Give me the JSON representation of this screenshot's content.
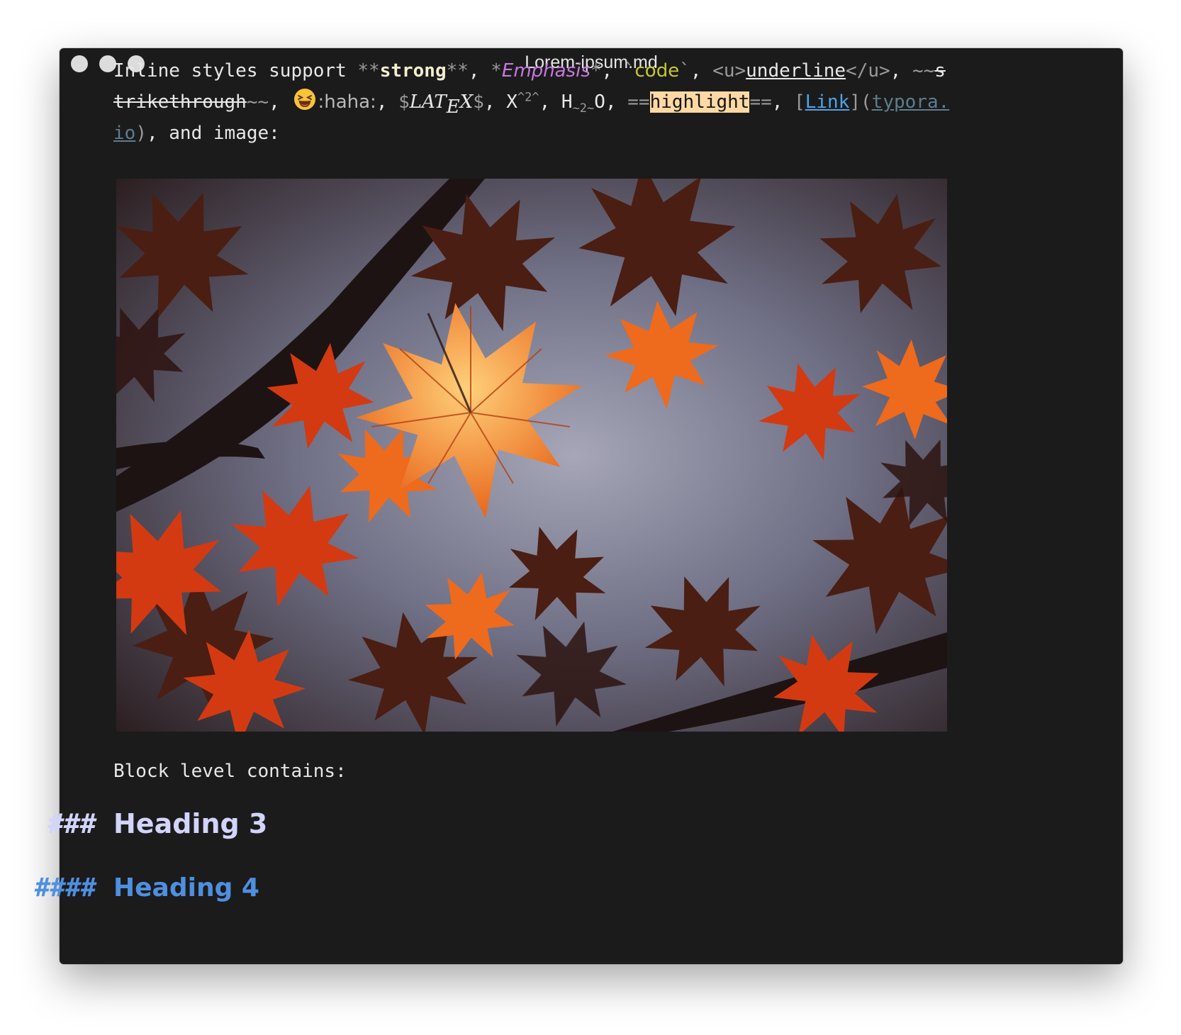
{
  "window": {
    "title": "Lorem-ipsum.md"
  },
  "paragraph": {
    "intro": "Inline styles support ",
    "strong_open": "**",
    "strong_text": "strong",
    "strong_close": "**",
    "sep1": ", ",
    "em_open": "*",
    "em_text": "Emphasis",
    "em_close": "*",
    "sep2": ", ",
    "code_open": "`",
    "code_text": "code",
    "code_close": "`",
    "sep3": ", ",
    "u_open": "<u>",
    "u_text": "underline",
    "u_close": "</u>",
    "sep4": ",",
    "strike_open": "~~",
    "strike_text": "strikethrough",
    "strike_close": "~~",
    "sep5": ", ",
    "emoji_code": ":haha:",
    "sep6": ", ",
    "latex_open": "$",
    "latex_la": "LA",
    "latex_t": "T",
    "latex_e": "E",
    "latex_x": "X",
    "latex_close": "$",
    "sep7": ", ",
    "sup_base": "X",
    "sup_mark": "^2^",
    "sep8": ", ",
    "sub_base": "H",
    "sub_mark": "~2~",
    "sub_tail": "O",
    "sep9": ", ",
    "hl_open": "==",
    "hl_text": "highlight",
    "hl_close": "==",
    "sep10": ", ",
    "link_open": "[",
    "link_text": "Link",
    "link_mid": "](",
    "link_url": "typora.io",
    "link_close": ")",
    "tail": ", and image:"
  },
  "image": {
    "icon": "maple-leaves-photo"
  },
  "block": {
    "text": "Block level contains:"
  },
  "heading3": {
    "hash": "###",
    "text": "Heading 3"
  },
  "heading4": {
    "hash": "####",
    "text": "Heading 4"
  },
  "colors": {
    "background": "#1b1b1b",
    "strong": "#f4eed0",
    "emphasis": "#c678dd",
    "code": "#c8c832",
    "highlight": "#fcd9a3",
    "link": "#4fa3e8",
    "heading3": "#d2d4fb",
    "heading4": "#4f8fe0"
  }
}
